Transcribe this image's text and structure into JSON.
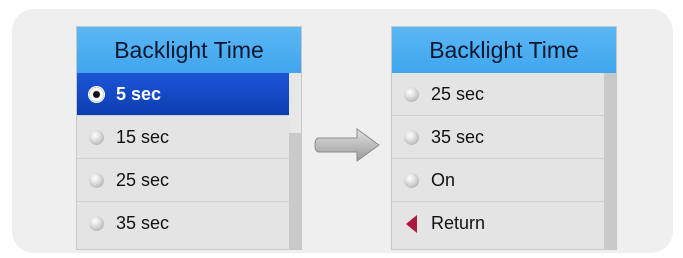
{
  "left_menu": {
    "title": "Backlight Time",
    "items": [
      {
        "label": "5 sec",
        "icon": "radio-selected-icon",
        "selected": true
      },
      {
        "label": "15 sec",
        "icon": "radio-icon",
        "selected": false
      },
      {
        "label": "25 sec",
        "icon": "radio-icon",
        "selected": false
      },
      {
        "label": "35 sec",
        "icon": "radio-icon",
        "selected": false
      }
    ]
  },
  "right_menu": {
    "title": "Backlight Time",
    "items": [
      {
        "label": "25 sec",
        "icon": "radio-icon"
      },
      {
        "label": "35 sec",
        "icon": "radio-icon"
      },
      {
        "label": "On",
        "icon": "radio-icon"
      },
      {
        "label": "Return",
        "icon": "return-arrow-icon"
      }
    ]
  },
  "colors": {
    "header": "#3fa6ee",
    "selected": "#0b3eb0",
    "return_arrow": "#b0173f"
  }
}
